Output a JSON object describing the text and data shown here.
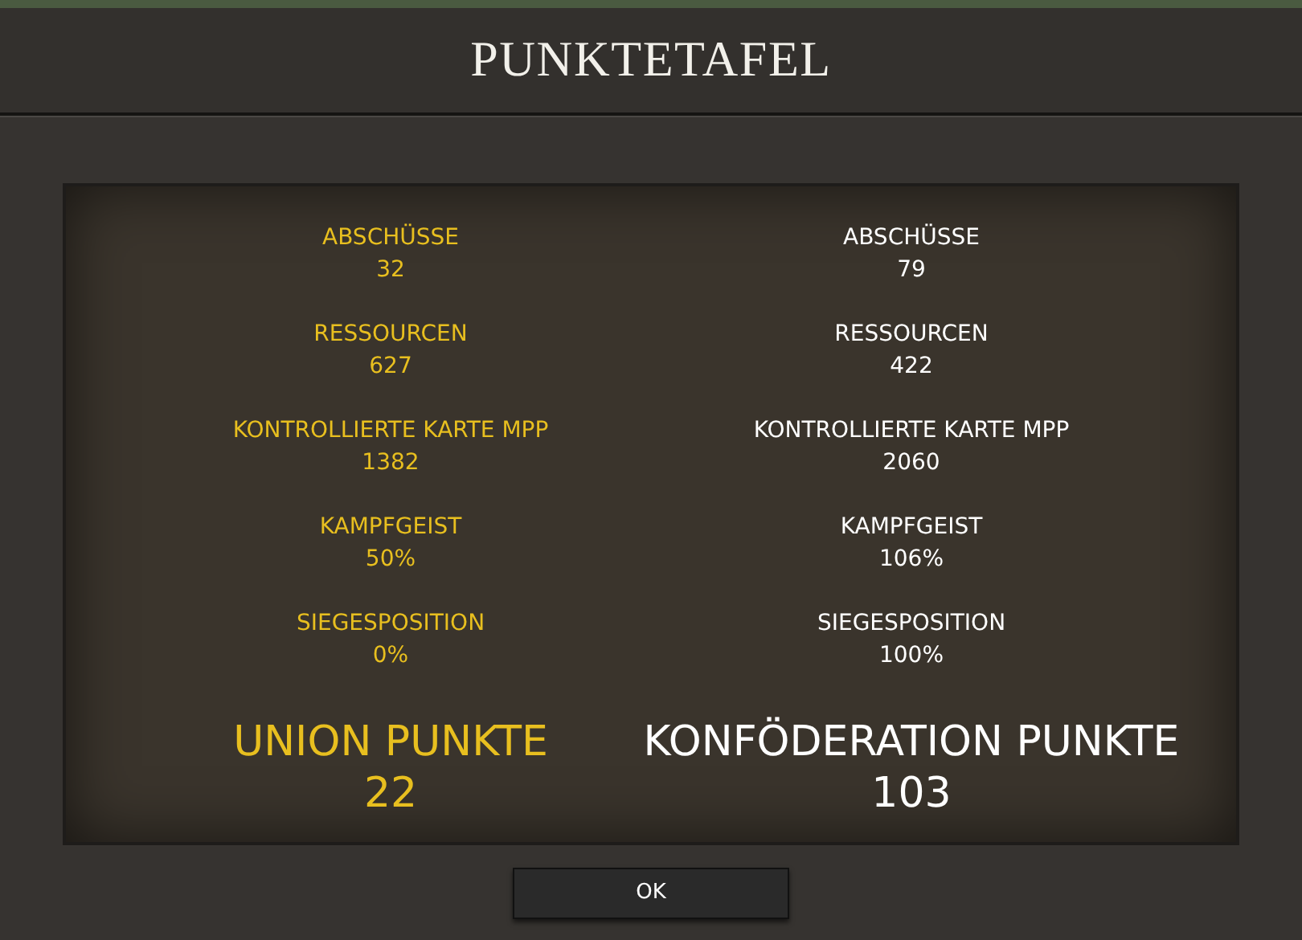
{
  "window": {
    "title": "PUNKTETAFEL"
  },
  "sides": [
    {
      "color": "#e8bf1f",
      "stats": [
        {
          "label": "ABSCHÜSSE",
          "value": "32"
        },
        {
          "label": "RESSOURCEN",
          "value": "627"
        },
        {
          "label": "KONTROLLIERTE KARTE MPP",
          "value": "1382"
        },
        {
          "label": "KAMPFGEIST",
          "value": "50%"
        },
        {
          "label": "SIEGESPOSITION",
          "value": "0%"
        }
      ],
      "total_label": "UNION PUNKTE",
      "total_value": "22"
    },
    {
      "color": "#ffffff",
      "stats": [
        {
          "label": "ABSCHÜSSE",
          "value": "79"
        },
        {
          "label": "RESSOURCEN",
          "value": "422"
        },
        {
          "label": "KONTROLLIERTE KARTE MPP",
          "value": "2060"
        },
        {
          "label": "KAMPFGEIST",
          "value": "106%"
        },
        {
          "label": "SIEGESPOSITION",
          "value": "100%"
        }
      ],
      "total_label": "KONFÖDERATION PUNKTE",
      "total_value": "103"
    }
  ],
  "buttons": [
    "OK"
  ]
}
